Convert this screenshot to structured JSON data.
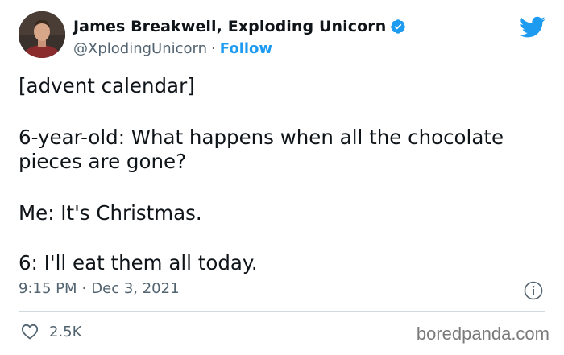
{
  "author": {
    "display_name": "James Breakwell, Exploding Unicorn",
    "handle": "@XplodingUnicorn",
    "separator": "·",
    "follow_label": "Follow",
    "verified": true
  },
  "tweet": {
    "line1": "[advent calendar]",
    "line2": "6-year-old: What happens when all the chocolate pieces are gone?",
    "line3": "Me: It's Christmas.",
    "line4": "6: I'll eat them all today."
  },
  "meta": {
    "time": "9:15 PM",
    "separator": "·",
    "date": "Dec 3, 2021"
  },
  "engagement": {
    "likes": "2.5K"
  },
  "watermark": "boredpanda.com",
  "icons": {
    "brand": "twitter-bird-icon",
    "verified": "verified-badge-icon",
    "info": "info-icon",
    "like": "heart-icon"
  },
  "colors": {
    "accent": "#1d9bf0",
    "text": "#0f1419",
    "secondary": "#536471",
    "divider": "#cfd9de"
  }
}
